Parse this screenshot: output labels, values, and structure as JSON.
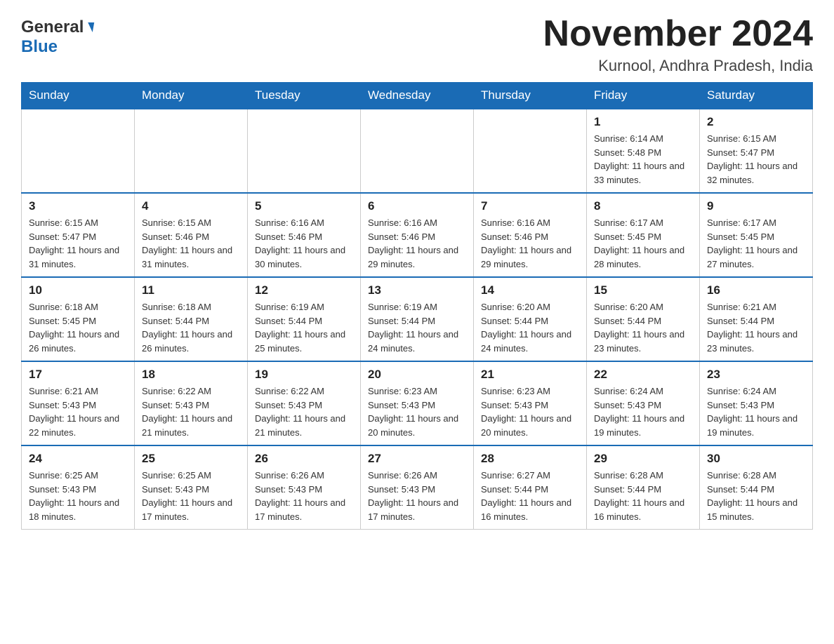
{
  "header": {
    "logo_general": "General",
    "logo_blue": "Blue",
    "month_title": "November 2024",
    "location": "Kurnool, Andhra Pradesh, India"
  },
  "days_of_week": [
    "Sunday",
    "Monday",
    "Tuesday",
    "Wednesday",
    "Thursday",
    "Friday",
    "Saturday"
  ],
  "weeks": [
    [
      {
        "day": "",
        "info": ""
      },
      {
        "day": "",
        "info": ""
      },
      {
        "day": "",
        "info": ""
      },
      {
        "day": "",
        "info": ""
      },
      {
        "day": "",
        "info": ""
      },
      {
        "day": "1",
        "info": "Sunrise: 6:14 AM\nSunset: 5:48 PM\nDaylight: 11 hours and 33 minutes."
      },
      {
        "day": "2",
        "info": "Sunrise: 6:15 AM\nSunset: 5:47 PM\nDaylight: 11 hours and 32 minutes."
      }
    ],
    [
      {
        "day": "3",
        "info": "Sunrise: 6:15 AM\nSunset: 5:47 PM\nDaylight: 11 hours and 31 minutes."
      },
      {
        "day": "4",
        "info": "Sunrise: 6:15 AM\nSunset: 5:46 PM\nDaylight: 11 hours and 31 minutes."
      },
      {
        "day": "5",
        "info": "Sunrise: 6:16 AM\nSunset: 5:46 PM\nDaylight: 11 hours and 30 minutes."
      },
      {
        "day": "6",
        "info": "Sunrise: 6:16 AM\nSunset: 5:46 PM\nDaylight: 11 hours and 29 minutes."
      },
      {
        "day": "7",
        "info": "Sunrise: 6:16 AM\nSunset: 5:46 PM\nDaylight: 11 hours and 29 minutes."
      },
      {
        "day": "8",
        "info": "Sunrise: 6:17 AM\nSunset: 5:45 PM\nDaylight: 11 hours and 28 minutes."
      },
      {
        "day": "9",
        "info": "Sunrise: 6:17 AM\nSunset: 5:45 PM\nDaylight: 11 hours and 27 minutes."
      }
    ],
    [
      {
        "day": "10",
        "info": "Sunrise: 6:18 AM\nSunset: 5:45 PM\nDaylight: 11 hours and 26 minutes."
      },
      {
        "day": "11",
        "info": "Sunrise: 6:18 AM\nSunset: 5:44 PM\nDaylight: 11 hours and 26 minutes."
      },
      {
        "day": "12",
        "info": "Sunrise: 6:19 AM\nSunset: 5:44 PM\nDaylight: 11 hours and 25 minutes."
      },
      {
        "day": "13",
        "info": "Sunrise: 6:19 AM\nSunset: 5:44 PM\nDaylight: 11 hours and 24 minutes."
      },
      {
        "day": "14",
        "info": "Sunrise: 6:20 AM\nSunset: 5:44 PM\nDaylight: 11 hours and 24 minutes."
      },
      {
        "day": "15",
        "info": "Sunrise: 6:20 AM\nSunset: 5:44 PM\nDaylight: 11 hours and 23 minutes."
      },
      {
        "day": "16",
        "info": "Sunrise: 6:21 AM\nSunset: 5:44 PM\nDaylight: 11 hours and 23 minutes."
      }
    ],
    [
      {
        "day": "17",
        "info": "Sunrise: 6:21 AM\nSunset: 5:43 PM\nDaylight: 11 hours and 22 minutes."
      },
      {
        "day": "18",
        "info": "Sunrise: 6:22 AM\nSunset: 5:43 PM\nDaylight: 11 hours and 21 minutes."
      },
      {
        "day": "19",
        "info": "Sunrise: 6:22 AM\nSunset: 5:43 PM\nDaylight: 11 hours and 21 minutes."
      },
      {
        "day": "20",
        "info": "Sunrise: 6:23 AM\nSunset: 5:43 PM\nDaylight: 11 hours and 20 minutes."
      },
      {
        "day": "21",
        "info": "Sunrise: 6:23 AM\nSunset: 5:43 PM\nDaylight: 11 hours and 20 minutes."
      },
      {
        "day": "22",
        "info": "Sunrise: 6:24 AM\nSunset: 5:43 PM\nDaylight: 11 hours and 19 minutes."
      },
      {
        "day": "23",
        "info": "Sunrise: 6:24 AM\nSunset: 5:43 PM\nDaylight: 11 hours and 19 minutes."
      }
    ],
    [
      {
        "day": "24",
        "info": "Sunrise: 6:25 AM\nSunset: 5:43 PM\nDaylight: 11 hours and 18 minutes."
      },
      {
        "day": "25",
        "info": "Sunrise: 6:25 AM\nSunset: 5:43 PM\nDaylight: 11 hours and 17 minutes."
      },
      {
        "day": "26",
        "info": "Sunrise: 6:26 AM\nSunset: 5:43 PM\nDaylight: 11 hours and 17 minutes."
      },
      {
        "day": "27",
        "info": "Sunrise: 6:26 AM\nSunset: 5:43 PM\nDaylight: 11 hours and 17 minutes."
      },
      {
        "day": "28",
        "info": "Sunrise: 6:27 AM\nSunset: 5:44 PM\nDaylight: 11 hours and 16 minutes."
      },
      {
        "day": "29",
        "info": "Sunrise: 6:28 AM\nSunset: 5:44 PM\nDaylight: 11 hours and 16 minutes."
      },
      {
        "day": "30",
        "info": "Sunrise: 6:28 AM\nSunset: 5:44 PM\nDaylight: 11 hours and 15 minutes."
      }
    ]
  ]
}
